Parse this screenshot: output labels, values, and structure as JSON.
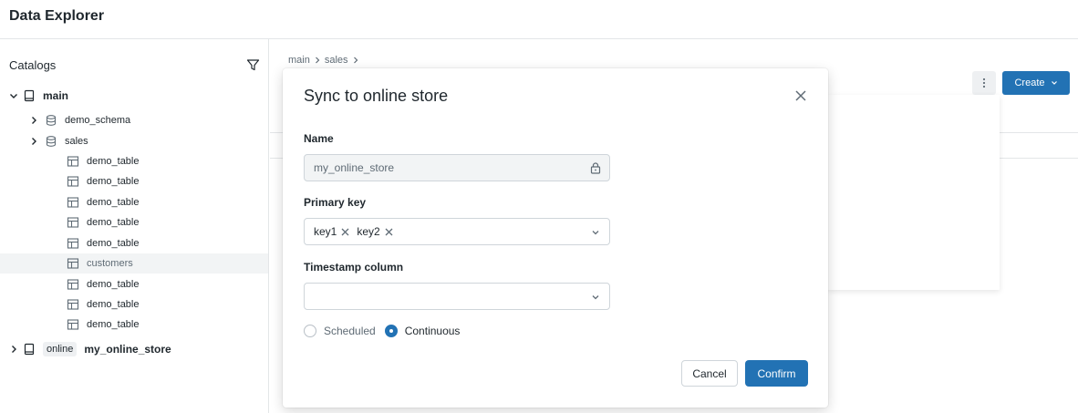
{
  "app": {
    "title": "Data Explorer"
  },
  "sidebar": {
    "heading": "Catalogs",
    "tree": {
      "main": "main",
      "demo_schema": "demo_schema",
      "sales": "sales",
      "tables": [
        "demo_table",
        "demo_table",
        "demo_table",
        "demo_table",
        "demo_table",
        "customers",
        "demo_table",
        "demo_table",
        "demo_table"
      ],
      "selected_table": "customers",
      "online_tag": "online",
      "online_store": "my_online_store"
    }
  },
  "breadcrumb": [
    "main",
    "sales"
  ],
  "toolbar": {
    "create_label": "Create"
  },
  "modal": {
    "title": "Sync to online store",
    "name_label": "Name",
    "name_value": "my_online_store",
    "primary_key_label": "Primary key",
    "primary_keys": [
      "key1",
      "key2"
    ],
    "timestamp_label": "Timestamp column",
    "timestamp_value": "",
    "mode_options": [
      "Scheduled",
      "Continuous"
    ],
    "mode_selected": "Continuous",
    "cancel_label": "Cancel",
    "confirm_label": "Confirm"
  },
  "colors": {
    "accent": "#2272b4",
    "border": "#cfd5da",
    "muted_text": "#5f6b75"
  }
}
